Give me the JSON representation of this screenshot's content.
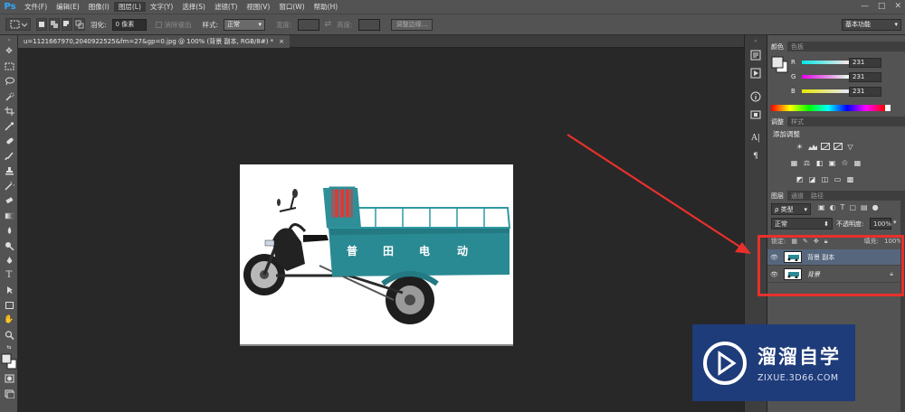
{
  "app": {
    "logo": "Ps"
  },
  "menu": [
    "文件(F)",
    "编辑(E)",
    "图像(I)",
    "图层(L)",
    "文字(Y)",
    "选择(S)",
    "滤镜(T)",
    "视图(V)",
    "窗口(W)",
    "帮助(H)"
  ],
  "window_controls": [
    "—",
    "□",
    "✕"
  ],
  "options": {
    "feather_label": "羽化:",
    "feather_value": "0 像素",
    "antialias_label": "消除锯齿",
    "style_label": "样式:",
    "style_value": "正常",
    "width_label": "宽度:",
    "height_label": "高度:",
    "refine_edge": "调整边缘...",
    "workspace": "基本功能"
  },
  "document": {
    "tab_title": "u=1121667970,2040922525&fm=27&gp=0.jpg @ 100% (背景 副本, RGB/8#) *",
    "close": "×",
    "vehicle_text": [
      "普",
      "田",
      "电",
      "动"
    ]
  },
  "color_panel": {
    "tabs": [
      "颜色",
      "色板"
    ],
    "channels": [
      {
        "letter": "R",
        "value": "231"
      },
      {
        "letter": "G",
        "value": "231"
      },
      {
        "letter": "B",
        "value": "231"
      }
    ]
  },
  "adjust_panel": {
    "tabs": [
      "调整",
      "样式"
    ],
    "title": "添加调整"
  },
  "layers_panel": {
    "tabs": [
      "图层",
      "通道",
      "路径"
    ],
    "filter_label": "ρ 类型",
    "blend_mode": "正常",
    "opacity_label": "不透明度:",
    "opacity_value": "100%",
    "lock_label": "锁定:",
    "fill_label": "填充:",
    "fill_value": "100%",
    "layers": [
      {
        "name": "背景 副本",
        "selected": true
      },
      {
        "name": "背景",
        "selected": false
      }
    ]
  },
  "watermark": {
    "brand": "溜溜自学",
    "url": "ZIXUE.3D66.COM"
  },
  "colors": {
    "accent_red": "#e8302c",
    "vehicle_teal": "#2a8a93",
    "watermark_bg": "#1e3b7a"
  }
}
